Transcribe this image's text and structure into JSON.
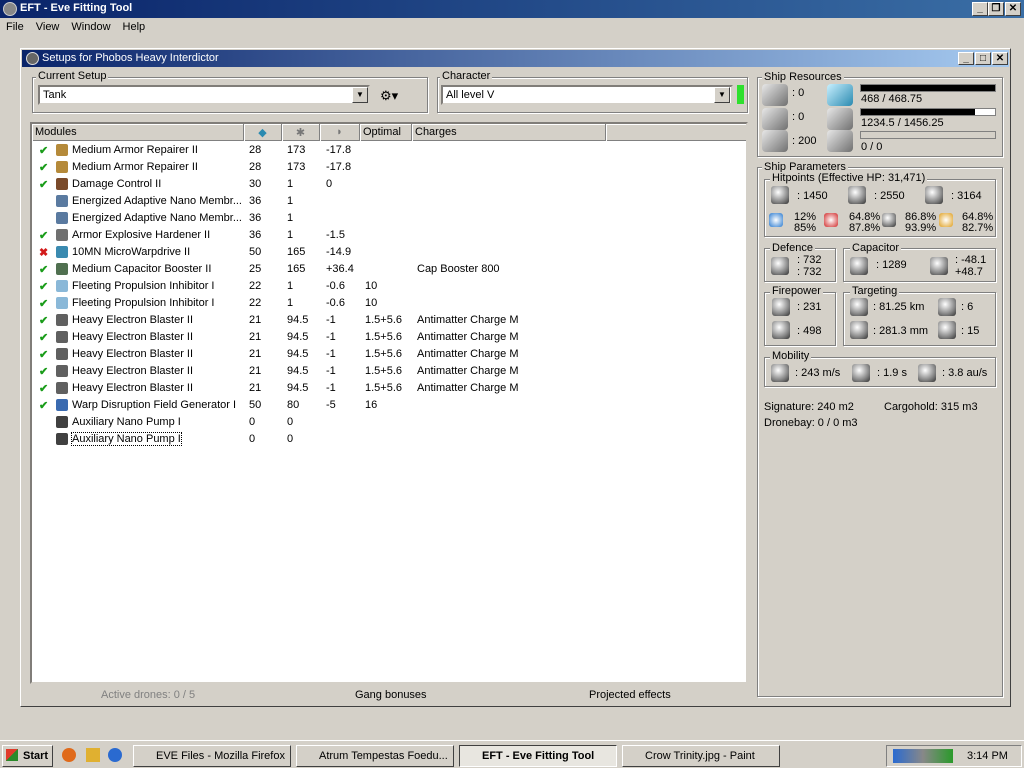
{
  "app": {
    "title": "EFT - Eve Fitting Tool"
  },
  "menu": [
    "File",
    "View",
    "Window",
    "Help"
  ],
  "child": {
    "title": "Setups for Phobos Heavy Interdictor"
  },
  "setup": {
    "label": "Current Setup",
    "value": "Tank"
  },
  "character": {
    "label": "Character",
    "value": "All level V"
  },
  "columns": {
    "modules": "Modules",
    "optimal": "Optimal",
    "charges": "Charges"
  },
  "modules": [
    {
      "mark": "✔",
      "name": "Medium Armor Repairer II",
      "cpu": "28",
      "pg": "173",
      "cap": "-17.8",
      "opt": "",
      "charge": ""
    },
    {
      "mark": "✔",
      "name": "Medium Armor Repairer II",
      "cpu": "28",
      "pg": "173",
      "cap": "-17.8",
      "opt": "",
      "charge": ""
    },
    {
      "mark": "✔",
      "name": "Damage Control II",
      "cpu": "30",
      "pg": "1",
      "cap": "0",
      "opt": "",
      "charge": ""
    },
    {
      "mark": "",
      "name": "Energized Adaptive Nano Membr...",
      "cpu": "36",
      "pg": "1",
      "cap": "",
      "opt": "",
      "charge": ""
    },
    {
      "mark": "",
      "name": "Energized Adaptive Nano Membr...",
      "cpu": "36",
      "pg": "1",
      "cap": "",
      "opt": "",
      "charge": ""
    },
    {
      "mark": "✔",
      "name": "Armor Explosive Hardener II",
      "cpu": "36",
      "pg": "1",
      "cap": "-1.5",
      "opt": "",
      "charge": ""
    },
    {
      "mark": "✖",
      "name": "10MN MicroWarpdrive II",
      "cpu": "50",
      "pg": "165",
      "cap": "-14.9",
      "opt": "",
      "charge": ""
    },
    {
      "mark": "✔",
      "name": "Medium Capacitor Booster II",
      "cpu": "25",
      "pg": "165",
      "cap": "+36.4",
      "opt": "",
      "charge": "Cap Booster 800"
    },
    {
      "mark": "✔",
      "name": "Fleeting Propulsion Inhibitor I",
      "cpu": "22",
      "pg": "1",
      "cap": "-0.6",
      "opt": "10",
      "charge": ""
    },
    {
      "mark": "✔",
      "name": "Fleeting Propulsion Inhibitor I",
      "cpu": "22",
      "pg": "1",
      "cap": "-0.6",
      "opt": "10",
      "charge": ""
    },
    {
      "mark": "✔",
      "name": "Heavy Electron Blaster II",
      "cpu": "21",
      "pg": "94.5",
      "cap": "-1",
      "opt": "1.5+5.6",
      "charge": "Antimatter Charge M"
    },
    {
      "mark": "✔",
      "name": "Heavy Electron Blaster II",
      "cpu": "21",
      "pg": "94.5",
      "cap": "-1",
      "opt": "1.5+5.6",
      "charge": "Antimatter Charge M"
    },
    {
      "mark": "✔",
      "name": "Heavy Electron Blaster II",
      "cpu": "21",
      "pg": "94.5",
      "cap": "-1",
      "opt": "1.5+5.6",
      "charge": "Antimatter Charge M"
    },
    {
      "mark": "✔",
      "name": "Heavy Electron Blaster II",
      "cpu": "21",
      "pg": "94.5",
      "cap": "-1",
      "opt": "1.5+5.6",
      "charge": "Antimatter Charge M"
    },
    {
      "mark": "✔",
      "name": "Heavy Electron Blaster II",
      "cpu": "21",
      "pg": "94.5",
      "cap": "-1",
      "opt": "1.5+5.6",
      "charge": "Antimatter Charge M"
    },
    {
      "mark": "✔",
      "name": "Warp Disruption Field Generator I",
      "cpu": "50",
      "pg": "80",
      "cap": "-5",
      "opt": "16",
      "charge": ""
    },
    {
      "mark": "",
      "name": "Auxiliary Nano Pump I",
      "cpu": "0",
      "pg": "0",
      "cap": "",
      "opt": "",
      "charge": ""
    },
    {
      "mark": "",
      "name": "Auxiliary Nano Pump I",
      "cpu": "0",
      "pg": "0",
      "cap": "",
      "opt": "",
      "charge": ""
    }
  ],
  "bottom_tabs": {
    "drones": "Active drones: 0 / 5",
    "gang": "Gang bonuses",
    "projected": "Projected effects"
  },
  "resources": {
    "label": "Ship Resources",
    "turrets": ": 0",
    "launchers": ": 0",
    "calibration": ": 200",
    "cpu": "468 / 468.75",
    "cpu_fill": 1.0,
    "powergrid": "1234.5 / 1456.25",
    "pg_fill": 0.848,
    "drone_bay": "0 / 0",
    "drone_fill": 0
  },
  "params": {
    "label": "Ship Parameters",
    "hitpoints": "Hitpoints (Effective HP: 31,471)",
    "shield": ": 1450",
    "armor": ": 2550",
    "structure": ": 3164",
    "res_a1": "12%",
    "res_a2": "85%",
    "res_b1": "64.8%",
    "res_b2": "87.8%",
    "res_c1": "86.8%",
    "res_c2": "93.9%",
    "res_d1": "64.8%",
    "res_d2": "82.7%",
    "defence_label": "Defence",
    "def1": ": 732",
    "def2": ": 732",
    "capacitor_label": "Capacitor",
    "cap_amount": ": 1289",
    "cap_rate1": ": -48.1",
    "cap_rate2": "+48.7",
    "firepower_label": "Firepower",
    "fp1": ": 231",
    "fp2": ": 498",
    "targeting_label": "Targeting",
    "range": ": 81.25 km",
    "targets": ": 6",
    "scan_res": ": 281.3 mm",
    "sensor": ": 15",
    "mobility_label": "Mobility",
    "velocity": ": 243 m/s",
    "align": ": 1.9 s",
    "warp": ": 3.8 au/s",
    "signature": "Signature: 240 m2",
    "cargohold": "Cargohold: 315 m3",
    "dronebay": "Dronebay: 0 / 0 m3"
  },
  "taskbar": {
    "start": "Start",
    "tasks": [
      "EVE Files - Mozilla Firefox",
      "Atrum Tempestas Foedu...",
      "EFT - Eve Fitting Tool",
      "Crow Trinity.jpg - Paint"
    ],
    "clock": "3:14 PM"
  }
}
